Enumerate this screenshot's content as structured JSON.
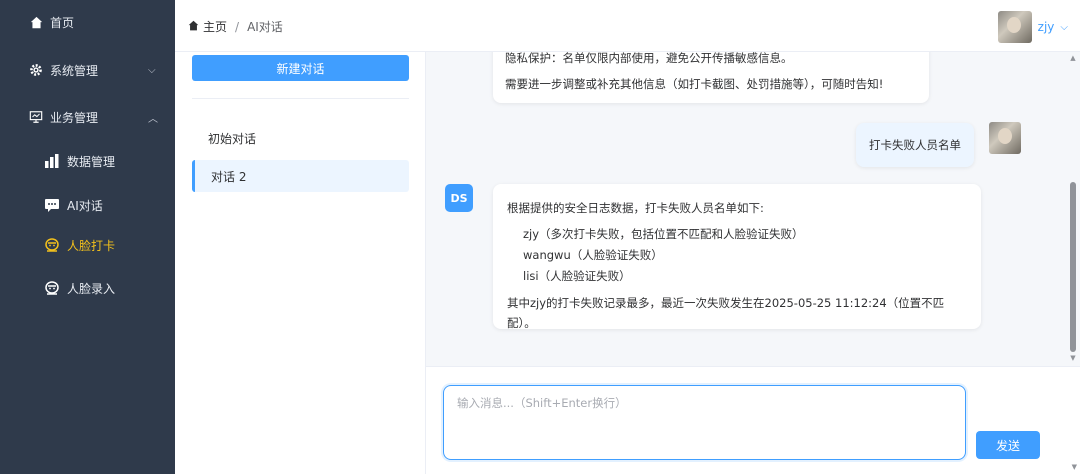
{
  "sidebar": {
    "items": [
      {
        "label": "首页",
        "icon": "home-icon"
      },
      {
        "label": "系统管理",
        "icon": "gear-icon",
        "expanded": false
      },
      {
        "label": "业务管理",
        "icon": "monitor-icon",
        "expanded": true
      },
      {
        "label": "数据管理",
        "icon": "bar-chart-icon"
      },
      {
        "label": "AI对话",
        "icon": "chat-icon"
      },
      {
        "label": "人脸打卡",
        "icon": "face-icon",
        "active": true
      },
      {
        "label": "人脸录入",
        "icon": "face-icon"
      }
    ]
  },
  "header": {
    "breadcrumb_home": "主页",
    "breadcrumb_sep": "/",
    "breadcrumb_current": "AI对话",
    "username": "zjy"
  },
  "conversations": {
    "new_label": "新建对话",
    "items": [
      "初始对话",
      "对话 2"
    ],
    "active_index": 1
  },
  "chat": {
    "prev_tail_1": "隐私保护：名单仅限内部使用，避免公开传播敏感信息。",
    "prev_tail_2": "需要进一步调整或补充其他信息（如打卡截图、处罚措施等），可随时告知!",
    "user_message": "打卡失败人员名单",
    "ai_badge": "DS",
    "ai_intro": "根据提供的安全日志数据，打卡失败人员名单如下:",
    "ai_list": [
      "zjy（多次打卡失败，包括位置不匹配和人脸验证失败）",
      "wangwu（人脸验证失败）",
      "lisi（人脸验证失败）"
    ],
    "ai_summary": "其中zjy的打卡失败记录最多，最近一次失败发生在2025-05-25 11:12:24（位置不匹配）。"
  },
  "composer": {
    "placeholder": "输入消息...（Shift+Enter换行）",
    "value": "",
    "send_label": "发送"
  },
  "colors": {
    "sidebar_bg": "#2f3a4b",
    "accent": "#409eff",
    "active_menu": "#f2c01c"
  }
}
